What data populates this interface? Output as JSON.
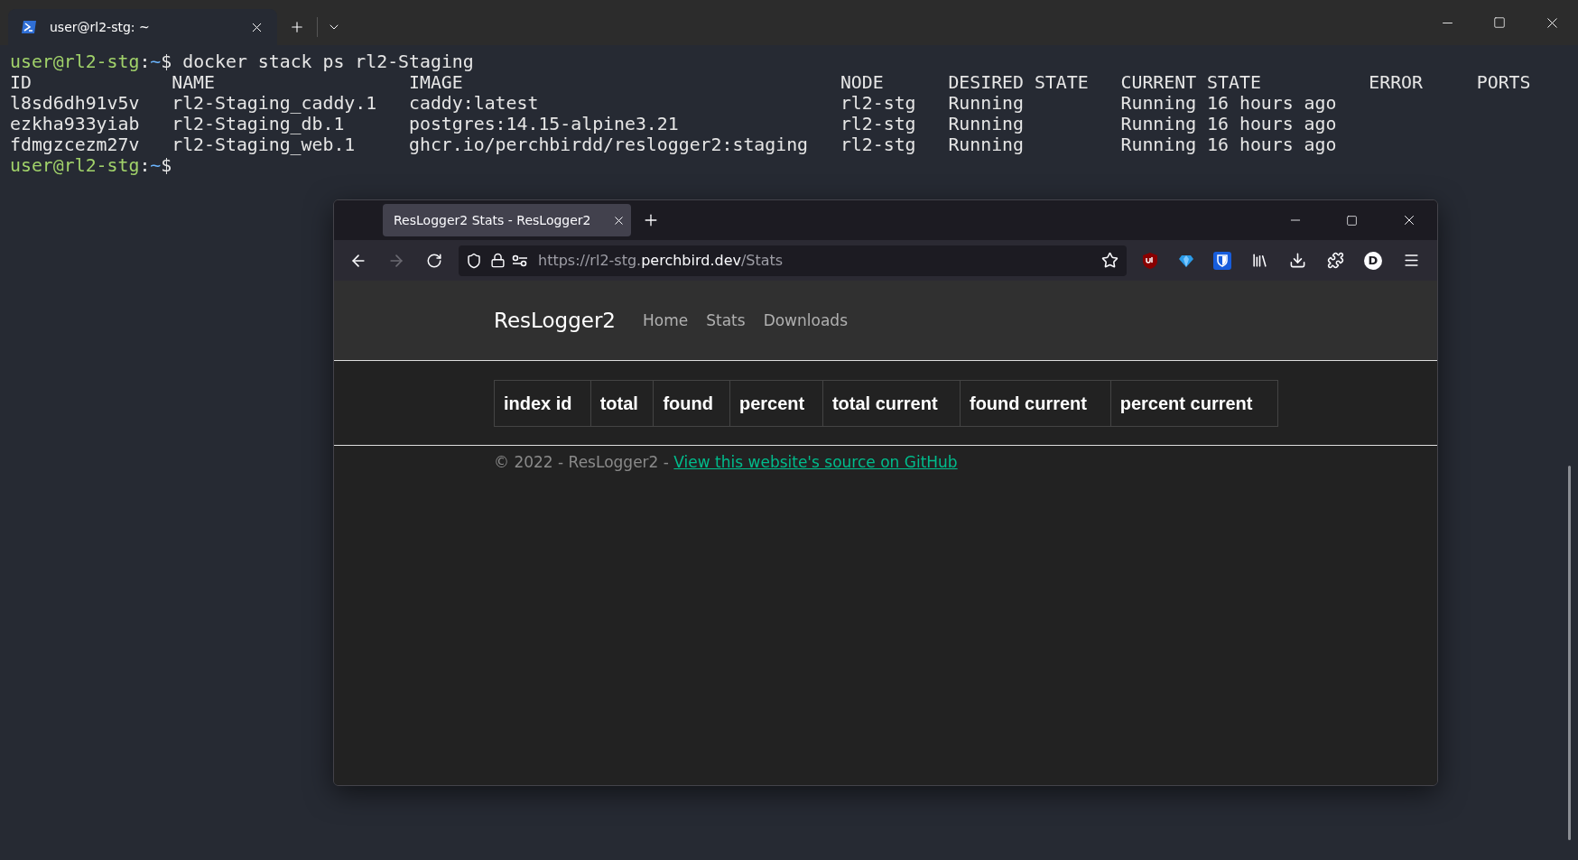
{
  "terminal": {
    "tabs": [
      {
        "title": "user@rl2-stg: ~",
        "selected": true
      }
    ],
    "command_prompt": {
      "user": "user@rl2-stg",
      "separator": ":",
      "path": "~",
      "symbol": "$",
      "command": "docker stack ps rl2-Staging"
    },
    "output": {
      "columns": [
        "ID",
        "NAME",
        "IMAGE",
        "NODE",
        "DESIRED STATE",
        "CURRENT STATE",
        "ERROR",
        "PORTS"
      ],
      "rows": [
        [
          "l8sd6dh91v5v",
          "rl2-Staging_caddy.1",
          "caddy:latest",
          "rl2-stg",
          "Running",
          "Running 16 hours ago"
        ],
        [
          "ezkha933yiab",
          "rl2-Staging_db.1",
          "postgres:14.15-alpine3.21",
          "rl2-stg",
          "Running",
          "Running 16 hours ago"
        ],
        [
          "fdmgzcezm27v",
          "rl2-Staging_web.1",
          "ghcr.io/perchbirdd/reslogger2:staging",
          "rl2-stg",
          "Running",
          "Running 16 hours ago"
        ]
      ]
    },
    "next_prompt": {
      "user": "user@rl2-stg",
      "separator": ":",
      "path": "~",
      "symbol": "$"
    }
  },
  "browser": {
    "tabs": [
      {
        "title": "ResLogger2 Stats - ResLogger2",
        "selected": true
      }
    ],
    "back": {
      "disabled": false
    },
    "forward": {
      "disabled": true
    },
    "url": {
      "prefix": "https://rl2-stg.",
      "domain": "perchbird.dev",
      "path": "/Stats"
    },
    "avatar_initial": "D",
    "page": {
      "brand": "ResLogger2",
      "nav": [
        {
          "label": "Home"
        },
        {
          "label": "Stats"
        },
        {
          "label": "Downloads"
        }
      ],
      "table": {
        "columns": [
          "index id",
          "total",
          "found",
          "percent",
          "total current",
          "found current",
          "percent current"
        ]
      },
      "footer": {
        "text": "© 2022 - ResLogger2 - ",
        "link": "View this website's source on GitHub"
      }
    }
  }
}
